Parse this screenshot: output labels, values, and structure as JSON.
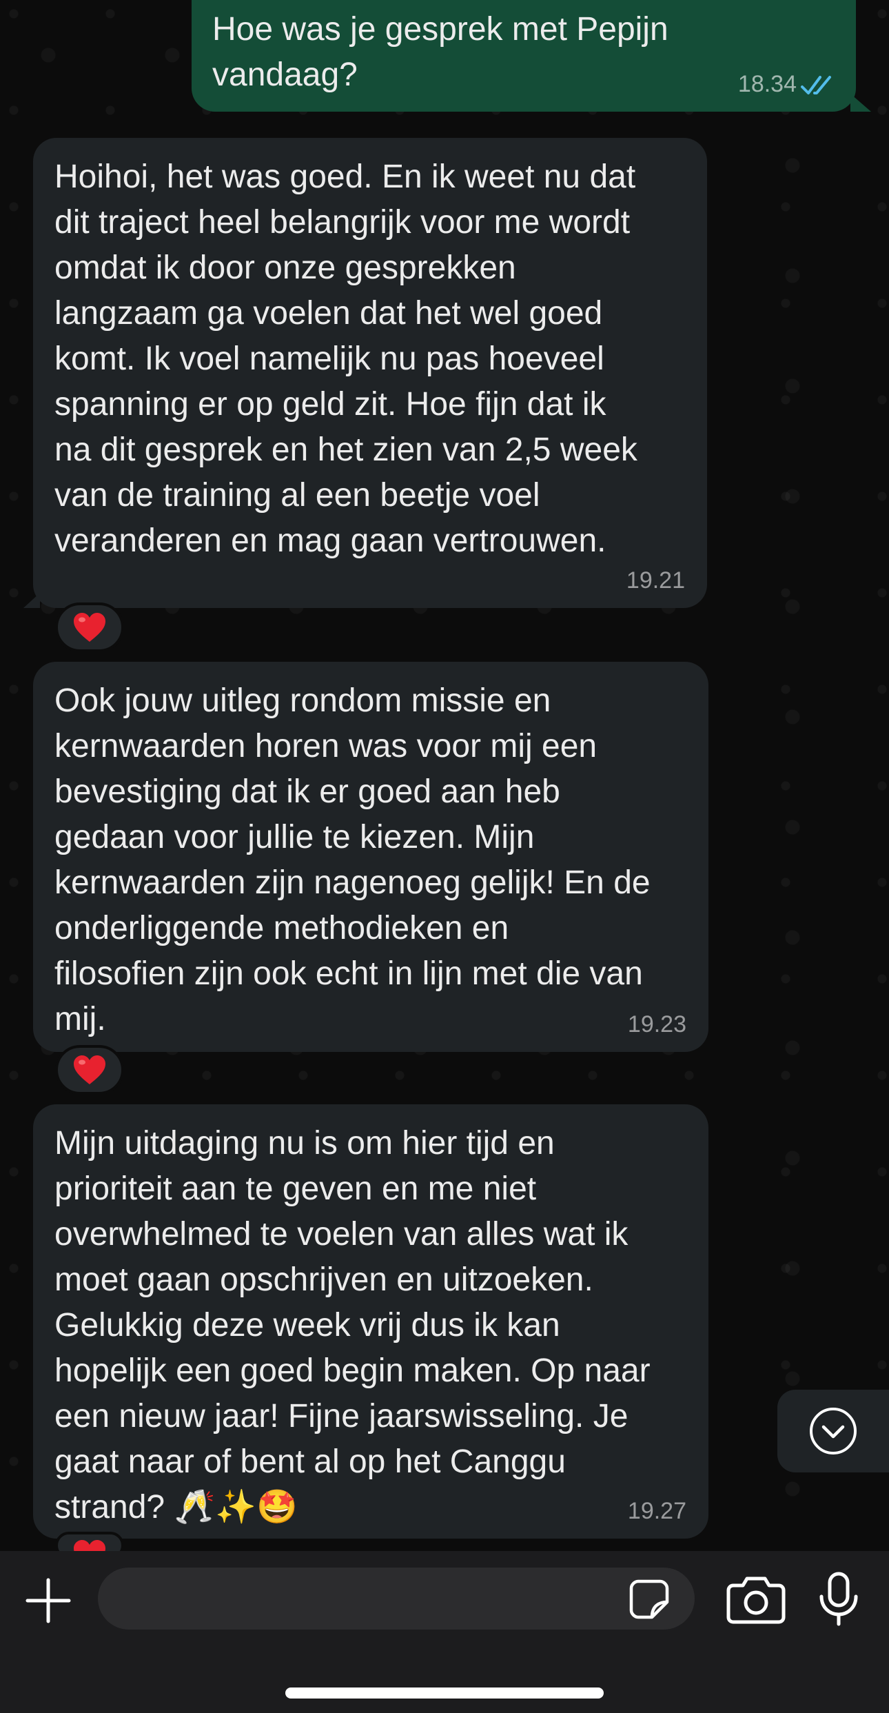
{
  "colors": {
    "outgoing_bubble": "#144d37",
    "incoming_bubble": "#1f2326",
    "read_ticks": "#53bdeb",
    "background": "#0b0b0b"
  },
  "messages": [
    {
      "direction": "outgoing",
      "text": "Hoe was je gesprek met Pepijn\nvandaag?",
      "time": "18.34",
      "status": "read"
    },
    {
      "direction": "incoming",
      "text": "Hoihoi, het was goed. En ik weet nu dat\ndit traject heel belangrijk voor me wordt\nomdat ik door onze gesprekken\nlangzaam ga voelen dat het wel goed\nkomt. Ik voel namelijk nu pas hoeveel\nspanning er op geld zit. Hoe fijn dat ik\nna dit gesprek en het zien van 2,5 week\nvan de training al een beetje voel\nveranderen en mag gaan vertrouwen.",
      "time": "19.21",
      "reaction": "❤️"
    },
    {
      "direction": "incoming",
      "text": "Ook jouw uitleg rondom missie en\nkernwaarden horen was voor mij een\nbevestiging dat ik er goed aan heb\ngedaan voor jullie te kiezen. Mijn\nkernwaarden zijn nagenoeg gelijk! En de\nonderliggende methodieken en\nfilosofien zijn ook echt in lijn met die van\nmij.",
      "time": "19.23",
      "reaction": "❤️"
    },
    {
      "direction": "incoming",
      "text": "Mijn uitdaging nu is om hier tijd en\nprioriteit aan te geven en me niet\noverwhelmed te voelen van alles wat ik\nmoet gaan opschrijven en uitzoeken.\nGelukkig deze week vrij dus ik kan\nhopelijk een goed begin maken. Op naar\neen nieuw jaar! Fijne jaarswisseling. Je\ngaat naar of bent al op het Canggu\nstrand? 🥂✨🤩",
      "time": "19.27",
      "reaction": "❤️"
    }
  ],
  "composer": {
    "placeholder": "",
    "icons": [
      "plus-icon",
      "sticker-icon",
      "camera-icon",
      "microphone-icon"
    ]
  },
  "scroll_button": {
    "icon": "chevron-down-icon"
  }
}
